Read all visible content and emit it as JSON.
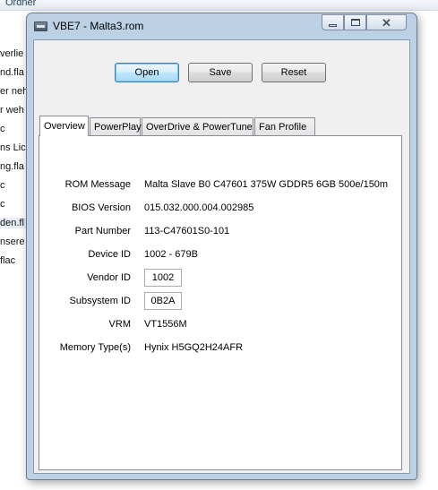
{
  "background": {
    "header_label": "Ordner",
    "items": [
      "verlie",
      "nd.fla",
      "er neh",
      "r weh",
      "c",
      "ns Lich",
      "ng.fla",
      "c",
      "c",
      "den.fl",
      "nsere",
      "flac"
    ]
  },
  "window": {
    "title": "VBE7 - Malta3.rom",
    "controls": {
      "minimize": "minimize",
      "maximize": "maximize",
      "close": "✕"
    }
  },
  "toolbar": {
    "open": "Open",
    "save": "Save",
    "reset": "Reset"
  },
  "tabs": [
    {
      "label": "Overview",
      "active": true
    },
    {
      "label": "PowerPlay",
      "active": false
    },
    {
      "label": "OverDrive & PowerTune",
      "active": false
    },
    {
      "label": "Fan Profile",
      "active": false
    }
  ],
  "overview": {
    "rom_message": {
      "label": "ROM Message",
      "value": "Malta Slave B0 C47601 375W GDDR5 6GB 500e/150m"
    },
    "bios_version": {
      "label": "BIOS Version",
      "value": "015.032.000.004.002985"
    },
    "part_number": {
      "label": "Part Number",
      "value": "113-C47601S0-101"
    },
    "device_id": {
      "label": "Device ID",
      "value": "1002 - 679B"
    },
    "vendor_id": {
      "label": "Vendor ID",
      "value": "1002"
    },
    "subsystem_id": {
      "label": "Subsystem ID",
      "value": "0B2A"
    },
    "vrm": {
      "label": "VRM",
      "value": "VT1556M"
    },
    "memory_type": {
      "label": "Memory Type(s)",
      "value": "Hynix H5GQ2H24AFR"
    }
  }
}
